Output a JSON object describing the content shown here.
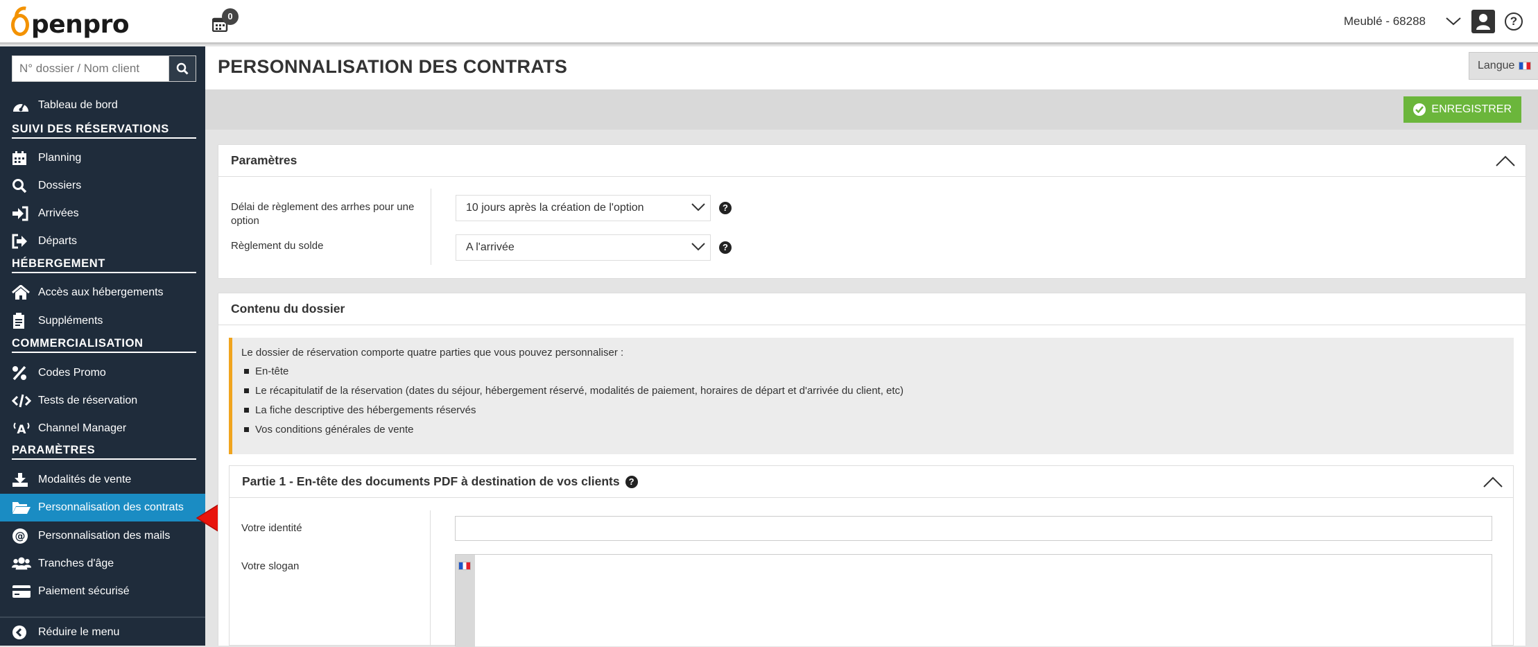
{
  "header": {
    "logo_text": "penpro",
    "notif_count": "0",
    "account_name": "Meublé - 68288"
  },
  "sidebar": {
    "search_placeholder": "N° dossier / Nom client",
    "dashboard": "Tableau de bord",
    "sections": {
      "reservations": "SUIVI DES RÉSERVATIONS",
      "hebergement": "HÉBERGEMENT",
      "commercialisation": "COMMERCIALISATION",
      "parametres": "PARAMÈTRES"
    },
    "items": {
      "planning": "Planning",
      "dossiers": "Dossiers",
      "arrivees": "Arrivées",
      "departs": "Départs",
      "acces": "Accès aux hébergements",
      "supplements": "Suppléments",
      "codes_promo": "Codes Promo",
      "tests": "Tests de réservation",
      "channel": "Channel Manager",
      "modalites": "Modalités de vente",
      "contrats": "Personnalisation des contrats",
      "mails": "Personnalisation des mails",
      "tranches": "Tranches d'âge",
      "paiement": "Paiement sécurisé",
      "reduire": "Réduire le menu"
    },
    "active_item": "contrats"
  },
  "main": {
    "title": "PERSONNALISATION DES CONTRATS",
    "langue_label": "Langue",
    "save_label": "ENREGISTRER",
    "parametres": {
      "title": "Paramètres",
      "delai_label": "Délai de règlement des arrhes pour une option",
      "delai_value": "10 jours après la création de l'option",
      "solde_label": "Règlement du solde",
      "solde_value": "A l'arrivée"
    },
    "contenu": {
      "title": "Contenu du dossier",
      "intro": "Le dossier de réservation comporte quatre parties que vous pouvez personnaliser :",
      "items": [
        "En-tête",
        "Le récapitulatif de la réservation (dates du séjour, hébergement réservé, modalités de paiement, horaires de départ et d'arrivée du client, etc)",
        "La fiche descriptive des hébergements réservés",
        "Vos conditions générales de vente"
      ]
    },
    "partie1": {
      "title": "Partie 1 - En-tête des documents PDF à destination de vos clients",
      "identite_label": "Votre identité",
      "identite_value": "",
      "slogan_label": "Votre slogan"
    }
  },
  "colors": {
    "sidebar_bg": "#1f2c3b",
    "active_item": "#1a8cc3",
    "save_green": "#6bb63b",
    "accent_orange": "#f39200",
    "info_border": "#f0a41e",
    "arrow_red": "#e8140c"
  }
}
